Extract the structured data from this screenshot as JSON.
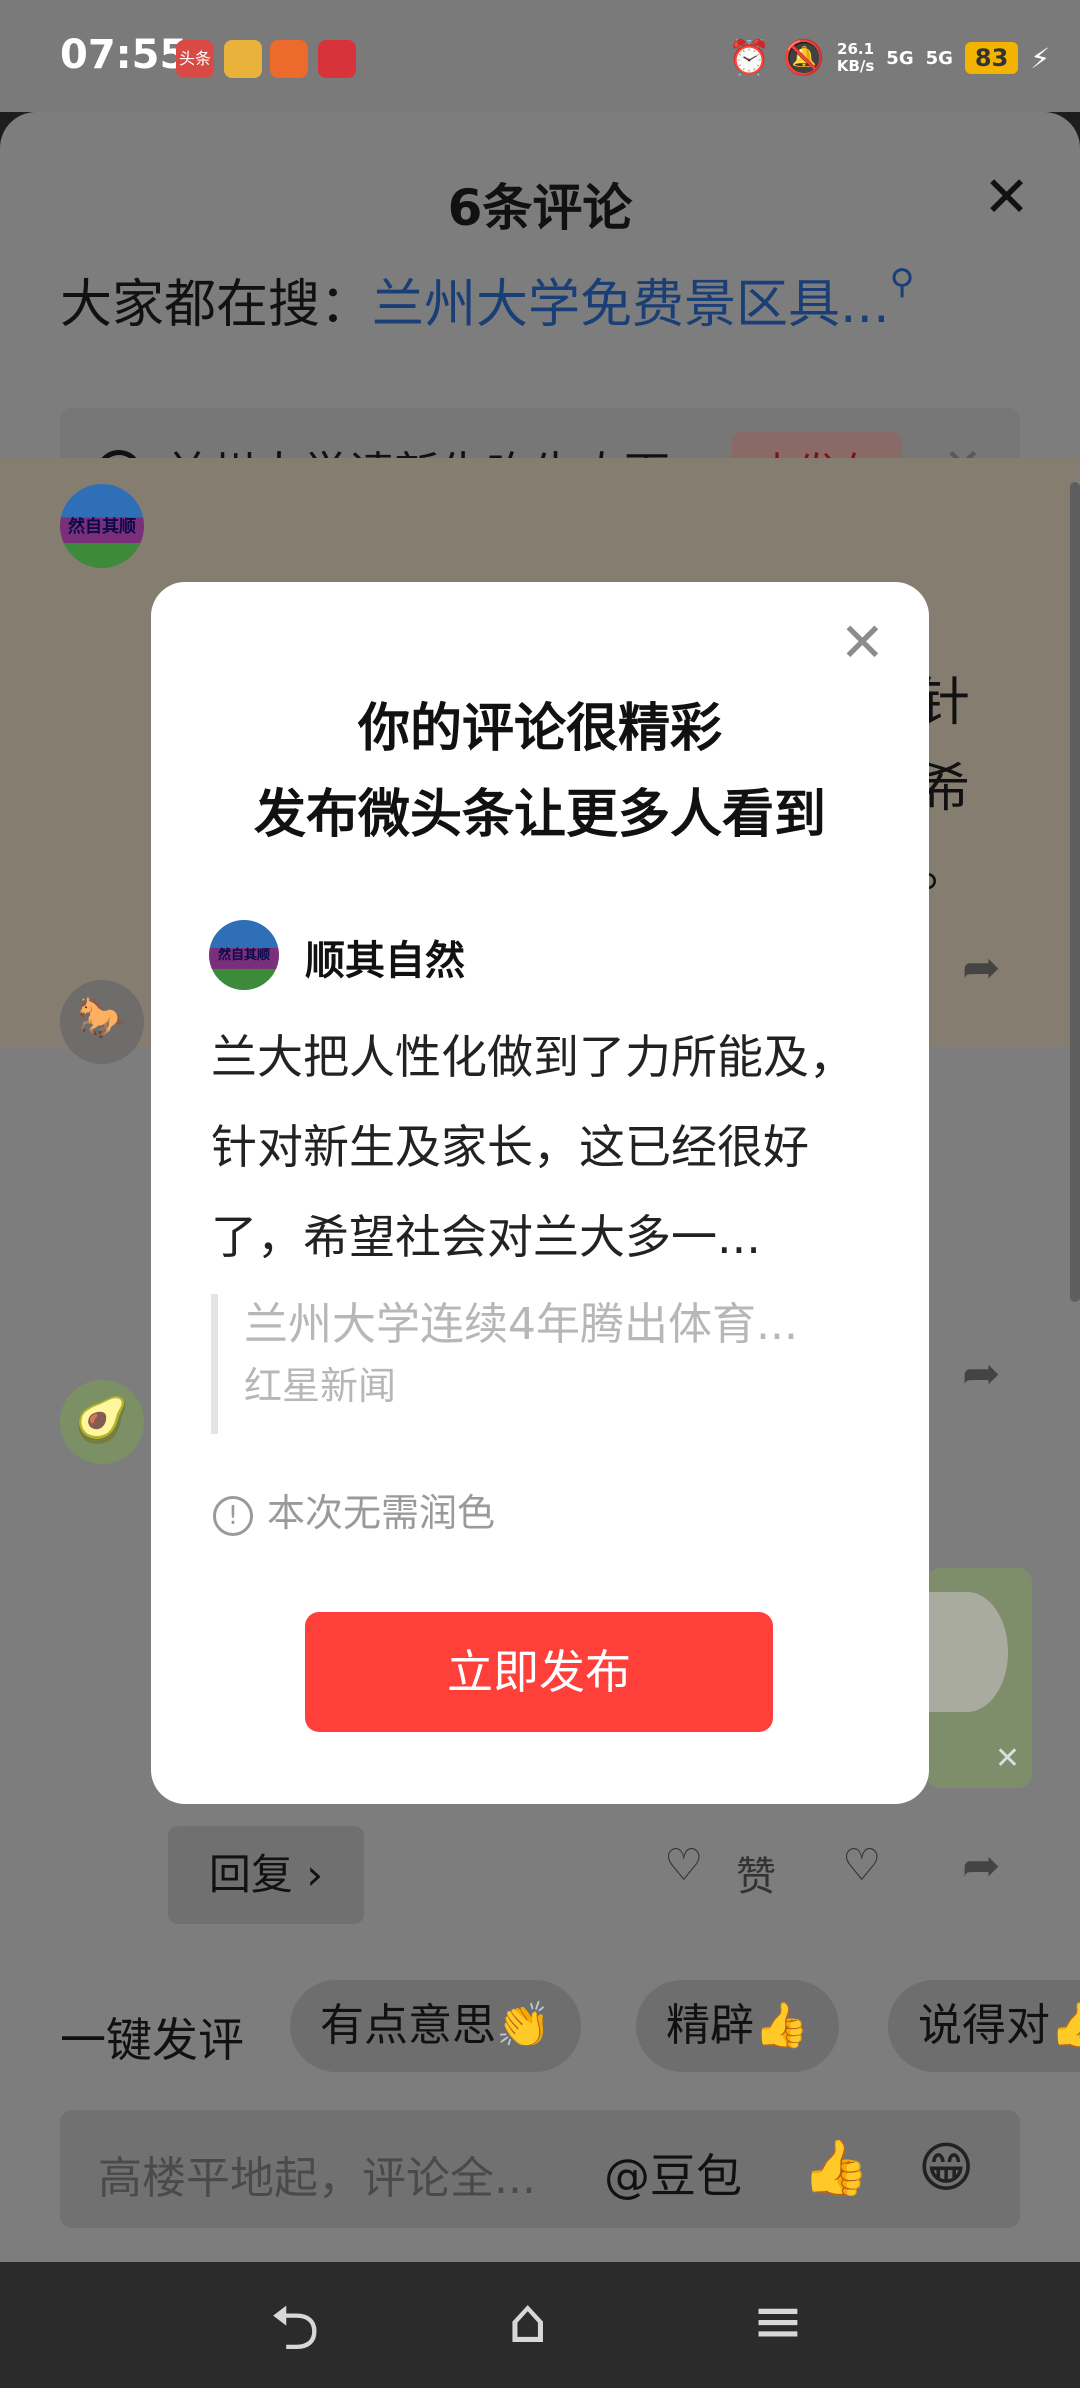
{
  "status_bar": {
    "time": "07:55",
    "app_icons": [
      "头条",
      "",
      "",
      ""
    ],
    "speed_value": "26.1",
    "speed_unit": "KB/s",
    "signal_1": "5G",
    "signal_2": "5G",
    "battery": "83"
  },
  "sheet": {
    "title": "6条评论",
    "search_prefix": "大家都在搜：",
    "search_link": "兰州大学免费景区具...",
    "topic_text": "兰州大学请新生吃牛肉面",
    "topic_button": "去发布",
    "comment1_side": [
      "针",
      "希",
      "。"
    ],
    "reply_button": "回复 ›",
    "like_label": "赞",
    "quick_comment_label": "一键发评",
    "quick_chips": [
      "有点意思👏",
      "精辟👍",
      "说得对👍"
    ],
    "input_placeholder": "高楼平地起，评论全...",
    "input_at": "@豆包",
    "input_emojis": [
      "👍",
      "😁"
    ]
  },
  "modal": {
    "title_line1": "你的评论很精彩",
    "title_line2": "发布微头条让更多人看到",
    "avatar_text": "然自其顺",
    "user_name": "顺其自然",
    "comment_text": "兰大把人性化做到了力所能及，针对新生及家长，这已经很好了，希望社会对兰大多一...",
    "quote_title": "兰州大学连续4年腾出体育...",
    "quote_source": "红星新闻",
    "hint": "本次无需润色",
    "publish_button": "立即发布"
  }
}
